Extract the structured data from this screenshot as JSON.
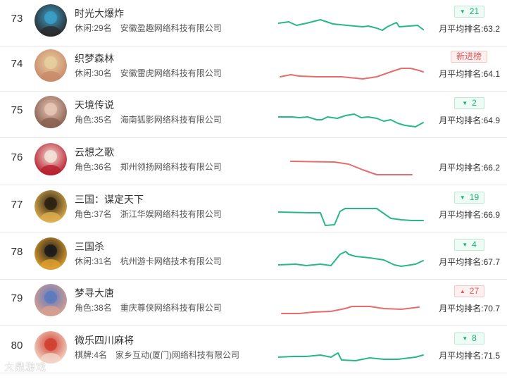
{
  "colors": {
    "up": "#1ab07a",
    "down": "#e05a5a",
    "trend_up": "#27b88a",
    "trend_down": "#e86c6c"
  },
  "rows": [
    {
      "rank": "73",
      "name": "时光大爆炸",
      "category": "休闲:29名",
      "company": "安徽盈趣网络科技有限公司",
      "change": {
        "type": "up",
        "value": "21"
      },
      "avg": "月平均排名:63.2",
      "trend": "up",
      "avatar_icon": "cartoon-avatar-icon"
    },
    {
      "rank": "74",
      "name": "织梦森林",
      "category": "休闲:30名",
      "company": "安徽雷虎网络科技有限公司",
      "change": {
        "type": "new",
        "value": "新进榜"
      },
      "avg": "月平均排名:64.1",
      "trend": "down",
      "avatar_icon": "anime-girl-avatar-icon"
    },
    {
      "rank": "75",
      "name": "天境传说",
      "category": "角色:35名",
      "company": "海南狐影网络科技有限公司",
      "change": {
        "type": "up",
        "value": "2"
      },
      "avg": "月平均排名:64.9",
      "trend": "up",
      "avatar_icon": "fantasy-girl-avatar-icon"
    },
    {
      "rank": "76",
      "name": "云想之歌",
      "category": "角色:36名",
      "company": "郑州领扬网络科技有限公司",
      "change": null,
      "avg": "月平均排名:66.2",
      "trend": "down",
      "avatar_icon": "costume-girl-avatar-icon"
    },
    {
      "rank": "77",
      "name": "三国：谋定天下",
      "category": "角色:37名",
      "company": "浙江华娱网络科技有限公司",
      "change": {
        "type": "up",
        "value": "19"
      },
      "avg": "月平均排名:66.9",
      "trend": "up",
      "avatar_icon": "calligraphy-logo-avatar-icon"
    },
    {
      "rank": "78",
      "name": "三国杀",
      "category": "休闲:31名",
      "company": "杭州游卡网络技术有限公司",
      "change": {
        "type": "up",
        "value": "4"
      },
      "avg": "月平均排名:67.7",
      "trend": "up",
      "avatar_icon": "sanguosha-logo-avatar-icon"
    },
    {
      "rank": "79",
      "name": "梦寻大唐",
      "category": "角色:38名",
      "company": "重庆尊侠网络科技有限公司",
      "change": {
        "type": "down",
        "value": "27"
      },
      "avg": "月平均排名:70.7",
      "trend": "down",
      "avatar_icon": "tang-girl-avatar-icon"
    },
    {
      "rank": "80",
      "name": "微乐四川麻将",
      "category": "棋牌:4名",
      "company": "家乡互动(厦门)网络科技有限公司",
      "change": {
        "type": "up",
        "value": "8"
      },
      "avg": "月平均排名:71.5",
      "trend": "up",
      "avatar_icon": "mahjong-avatar-icon"
    }
  ],
  "watermark": "大鼎游戏"
}
